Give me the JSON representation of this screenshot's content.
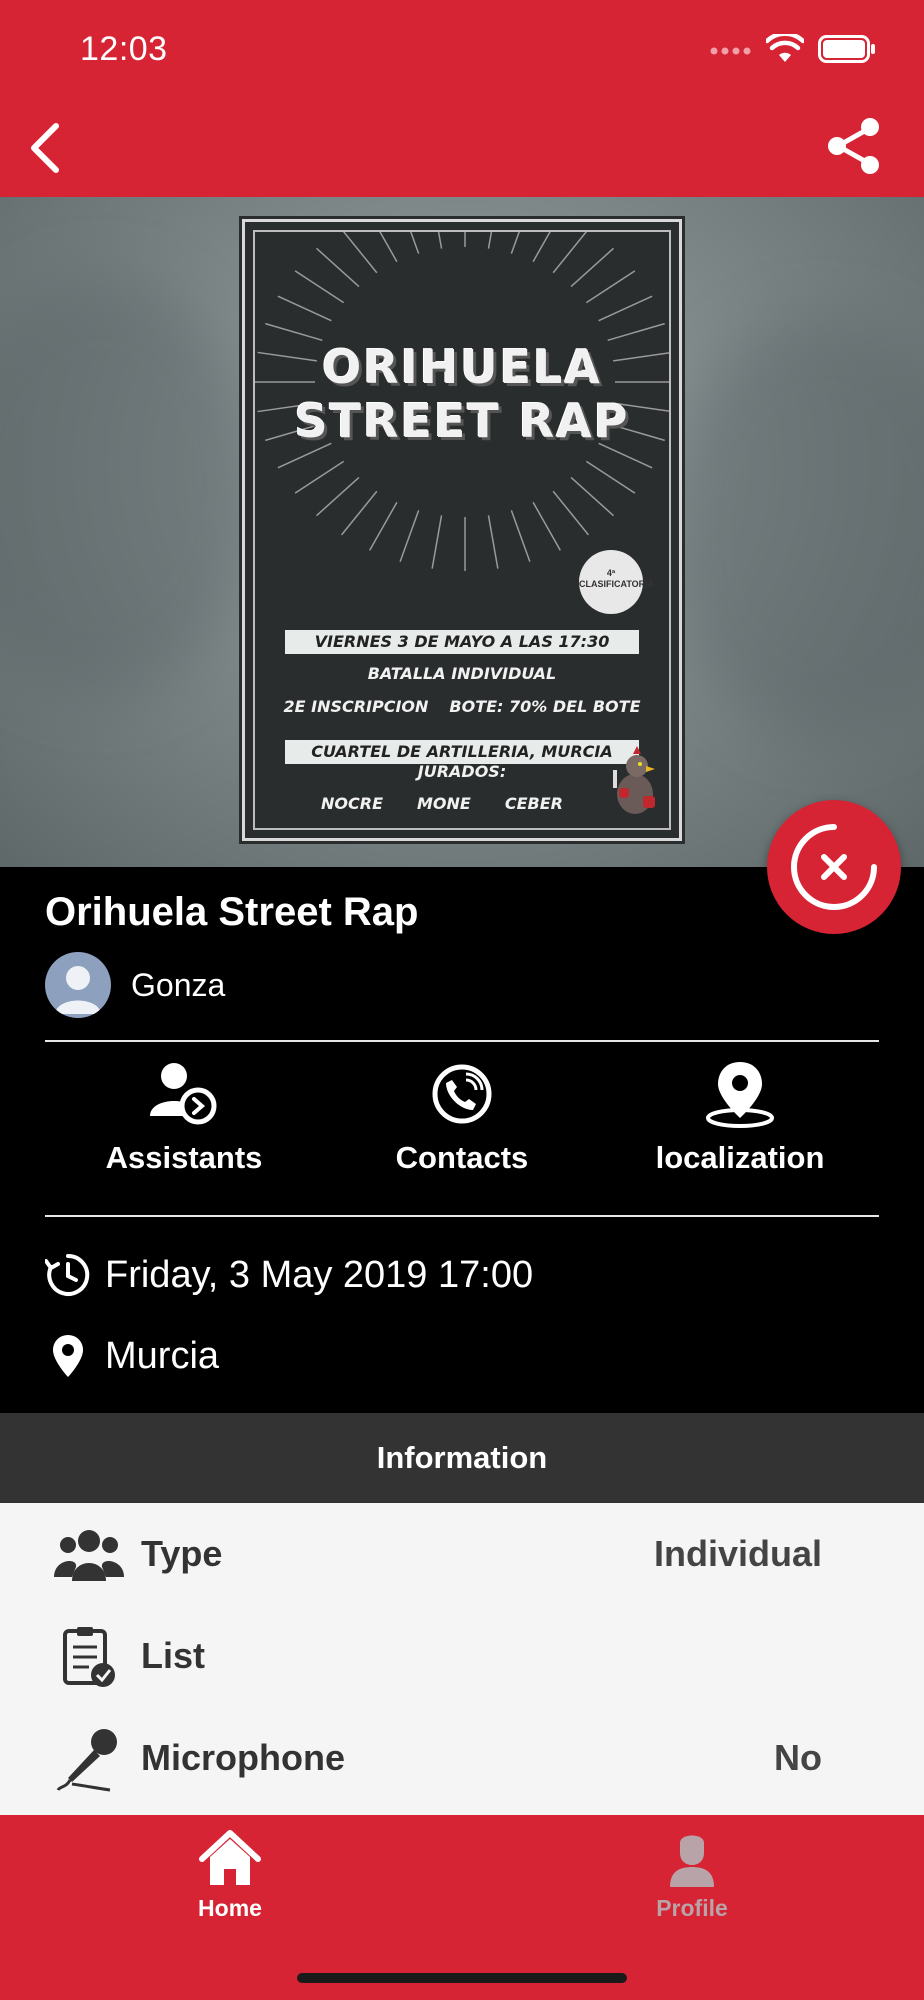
{
  "status_bar": {
    "time": "12:03"
  },
  "header": {
    "back_icon": "chevron-left-icon",
    "share_icon": "share-icon"
  },
  "poster": {
    "title_line1": "ORIHUELA",
    "title_line2": "STREET RAP",
    "badge": "4ª CLASIFICATORIA",
    "date_line": "VIERNES 3 DE MAYO A LAS 17:30",
    "battle_type": "BATALLA INDIVIDUAL",
    "inscription": "2E INSCRIPCION",
    "prize": "BOTE: 70% DEL BOTE",
    "venue": "CUARTEL DE ARTILLERIA, MURCIA",
    "jury_heading": "JURADOS:",
    "jury": [
      "NOCRE",
      "MONE",
      "CEBER"
    ]
  },
  "event": {
    "title": "Orihuela Street Rap",
    "author": "Gonza",
    "date": "Friday, 3 May 2019 17:00",
    "location": "Murcia"
  },
  "actions": [
    {
      "label": "Assistants",
      "icon": "assistants-icon"
    },
    {
      "label": "Contacts",
      "icon": "phone-icon"
    },
    {
      "label": "localization",
      "icon": "location-pin-icon"
    }
  ],
  "information": {
    "heading": "Information",
    "rows": [
      {
        "label": "Type",
        "value": "Individual",
        "icon": "group-icon"
      },
      {
        "label": "List",
        "value": "",
        "icon": "checklist-icon"
      },
      {
        "label": "Microphone",
        "value": "No",
        "icon": "microphone-icon"
      }
    ]
  },
  "bottom_nav": [
    {
      "label": "Home",
      "icon": "home-icon",
      "active": true
    },
    {
      "label": "Profile",
      "icon": "profile-icon",
      "active": false
    }
  ],
  "colors": {
    "brand_red": "#d62434",
    "info_bar": "#333333",
    "inactive_nav": "#b8a3a8"
  }
}
